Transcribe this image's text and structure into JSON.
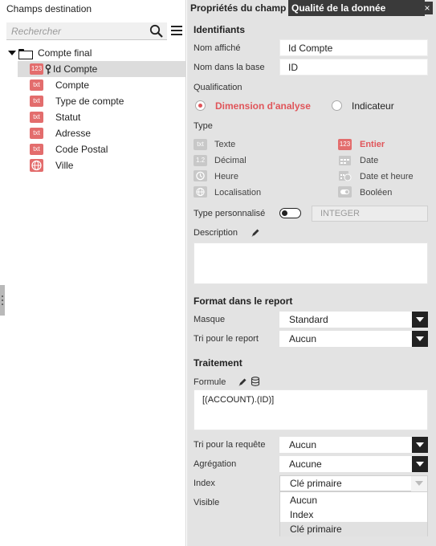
{
  "left_panel": {
    "title": "Champs destination",
    "search": {
      "placeholder": "Rechercher"
    },
    "tree": {
      "root_label": "Compte final",
      "items": [
        {
          "badge": "123",
          "label": "Id Compte"
        },
        {
          "badge": "txt",
          "label": "Compte"
        },
        {
          "badge": "txt",
          "label": "Type de compte"
        },
        {
          "badge": "txt",
          "label": "Statut"
        },
        {
          "badge": "txt",
          "label": "Adresse"
        },
        {
          "badge": "txt",
          "label": "Code Postal"
        },
        {
          "badge": "globe",
          "label": "Ville"
        }
      ]
    }
  },
  "right_panel": {
    "tabs": [
      {
        "label": "Propriétés du champ"
      },
      {
        "label": "Qualité de la donnée"
      }
    ],
    "close_label": "×",
    "identifiants": {
      "title": "Identifiants",
      "display_name_label": "Nom affiché",
      "display_name_value": "Id Compte",
      "db_name_label": "Nom dans la base",
      "db_name_value": "ID"
    },
    "qualification": {
      "label": "Qualification",
      "options": [
        {
          "label": "Dimension d'analyse",
          "selected": true
        },
        {
          "label": "Indicateur",
          "selected": false
        }
      ]
    },
    "type": {
      "label": "Type",
      "options": [
        {
          "label": "Texte",
          "icon": "txt"
        },
        {
          "label": "Entier",
          "icon": "123",
          "selected": true
        },
        {
          "label": "Décimal",
          "icon": "1.2"
        },
        {
          "label": "Date",
          "icon": "calendar-icon"
        },
        {
          "label": "Heure",
          "icon": "clock-icon"
        },
        {
          "label": "Date et heure",
          "icon": "calendar-clock-icon"
        },
        {
          "label": "Localisation",
          "icon": "globe-icon"
        },
        {
          "label": "Booléen",
          "icon": "toggle-icon"
        }
      ]
    },
    "custom_type": {
      "label": "Type personnalisé",
      "value": "INTEGER",
      "enabled": false
    },
    "description": {
      "label": "Description",
      "value": ""
    },
    "format": {
      "title": "Format dans le report",
      "mask_label": "Masque",
      "mask_value": "Standard",
      "sort_label": "Tri pour le report",
      "sort_value": "Aucun"
    },
    "traitement": {
      "title": "Traitement",
      "formula_label": "Formule",
      "formula_value": "[(ACCOUNT).(ID)]",
      "query_sort_label": "Tri pour la requête",
      "query_sort_value": "Aucun",
      "aggregation_label": "Agrégation",
      "aggregation_value": "Aucune",
      "index_label": "Index",
      "index_value": "Clé primaire",
      "index_options": [
        "Aucun",
        "Index",
        "Clé primaire"
      ],
      "visible_label": "Visible"
    }
  },
  "colors": {
    "accent_red": "#e0555a",
    "badge_red": "#e36d6d",
    "tab_dark": "#3a3a3a",
    "panel_gray": "#e3e3e3"
  }
}
